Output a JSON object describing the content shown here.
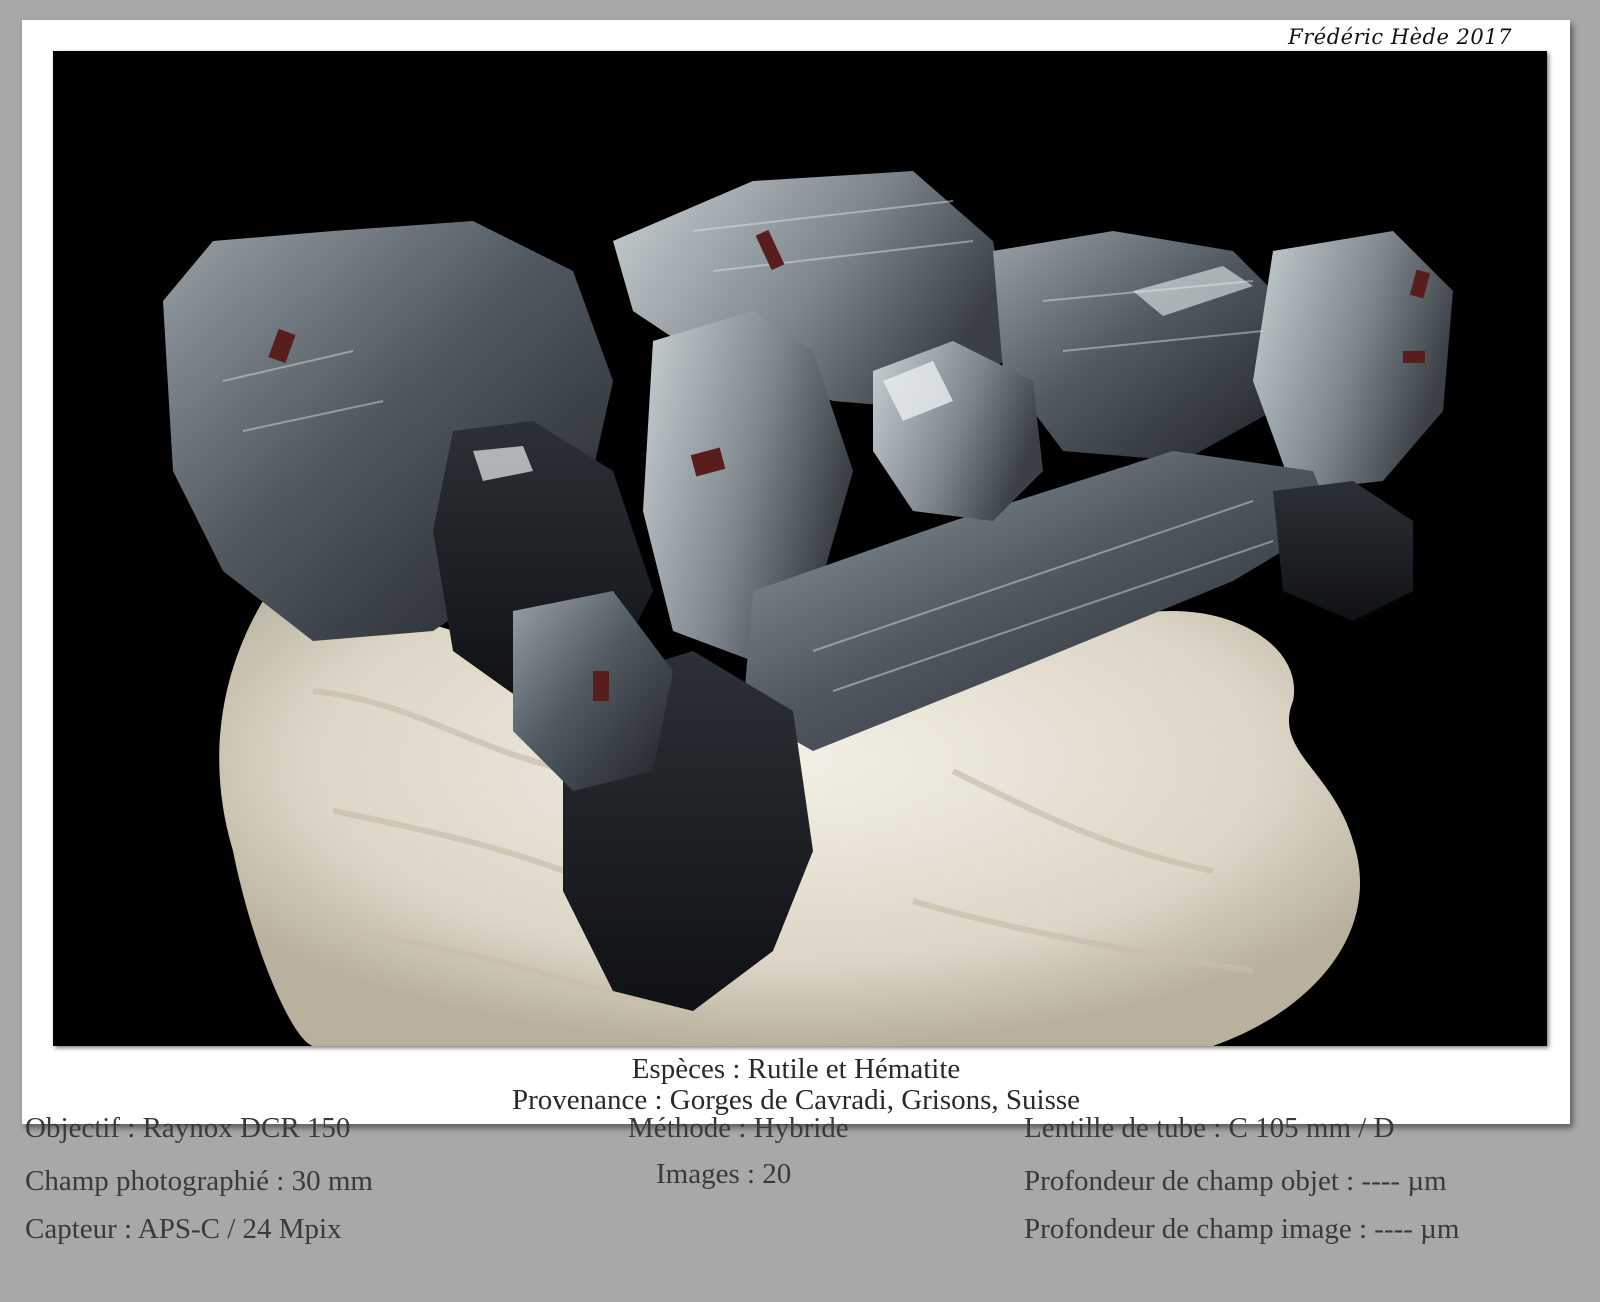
{
  "signature": "Frédéric Hède 2017",
  "photo": {
    "subject_colors": {
      "background": "#000000",
      "crystal": "#4a5058",
      "crystal_highlight": "#c4ccd0",
      "matrix": "#e6e1d6",
      "rutile": "#5a1d1d"
    }
  },
  "caption": {
    "species": "Espèces : Rutile et Hématite",
    "provenance": "Provenance : Gorges de Cavradi, Grisons, Suisse"
  },
  "info": {
    "objective": "Objectif : Raynox DCR 150",
    "field": "Champ photographié : 30 mm",
    "sensor": "Capteur : APS-C / 24 Mpix",
    "method": "Méthode : Hybride",
    "images": "Images : 20",
    "tube_lens": "Lentille de tube : C 105 mm / D",
    "dof_object": "Profondeur de champ objet : ---- µm",
    "dof_image": "Profondeur de champ image : ---- µm"
  }
}
